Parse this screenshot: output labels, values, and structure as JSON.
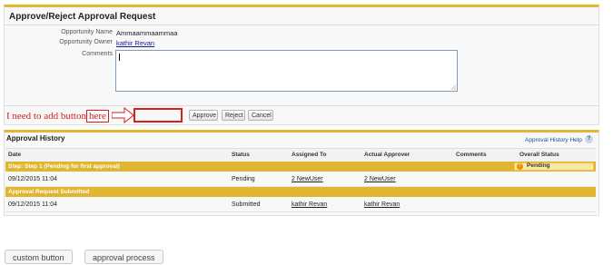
{
  "approval": {
    "title": "Approve/Reject Approval Request",
    "fields": {
      "opportunity_name_label": "Opportunity Name",
      "opportunity_name_value": "Ammaammaammaa",
      "opportunity_owner_label": "Opportunity Owner",
      "opportunity_owner_value": "kathir Revan",
      "comments_label": "Comments",
      "comments_value": ""
    },
    "annotation": {
      "note": "I need to add button",
      "here": "here"
    },
    "buttons": {
      "approve": "Approve",
      "reject": "Reject",
      "cancel": "Cancel"
    }
  },
  "history": {
    "title": "Approval History",
    "help_link": "Approval History Help",
    "columns": [
      "Date",
      "Status",
      "Assigned To",
      "Actual Approver",
      "Comments",
      "Overall Status"
    ],
    "groups": [
      {
        "header": "Step: Step 1 (Pending for first approval)",
        "overall_status": "Pending",
        "rows": [
          {
            "date": "09/12/2015 11:04",
            "status": "Pending",
            "assigned_to": "2 NewUser",
            "actual_approver": "2 NewUser",
            "comments": ""
          }
        ]
      },
      {
        "header": "Approval Request Submitted",
        "overall_status": "",
        "rows": [
          {
            "date": "09/12/2015 11:04",
            "status": "Submitted",
            "assigned_to": "kathir Revan",
            "actual_approver": "kathir Revan",
            "comments": ""
          }
        ]
      }
    ]
  },
  "bottom_buttons": {
    "custom_button": "custom button",
    "approval_process": "approval process"
  },
  "colors": {
    "accent_gold": "#e0b52f",
    "annotation_red": "#d42020",
    "link_blue": "#1a4f9c"
  }
}
